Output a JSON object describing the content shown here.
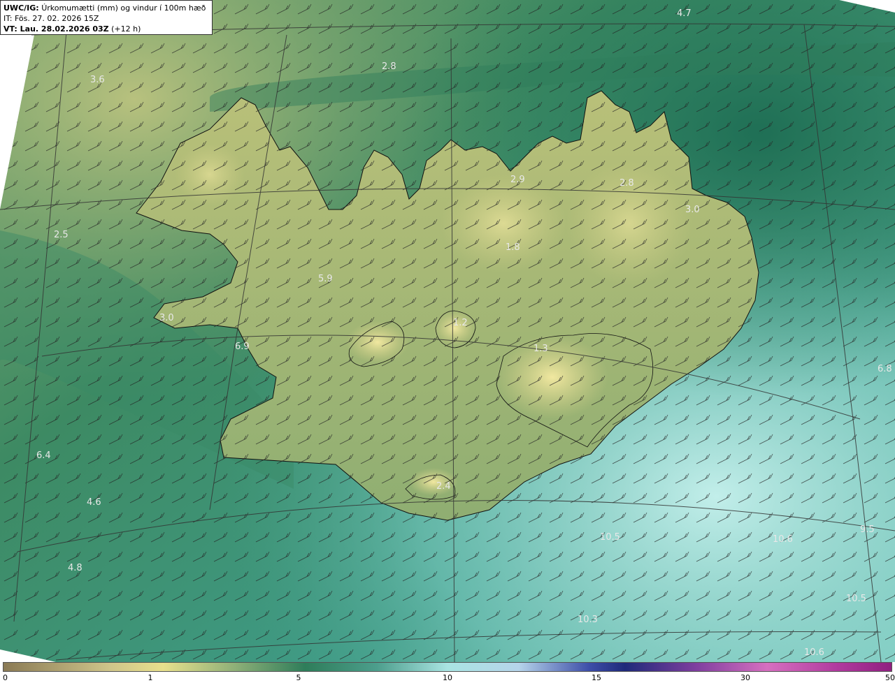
{
  "header": {
    "model_label": "UWC/IG:",
    "title": "Úrkomumætti (mm) og vindur í 100m hæð",
    "init_time": "IT: Fös. 27. 02. 2026 15Z",
    "valid_label": "VT: Lau. 28.02.2026 03Z",
    "valid_offset": "(+12 h)"
  },
  "map": {
    "region": "Iceland",
    "field": "precipitable water (mm)",
    "overlay": "wind barbs at 100 m",
    "colors": {
      "dry": "#8f8060",
      "low": "#e6df8a",
      "mid": "#2e7d5a",
      "high": "#a8e6e3",
      "coast": "#111111",
      "grid": "#333333"
    },
    "value_labels": [
      {
        "id": "v1",
        "text": "4.7"
      },
      {
        "id": "v2",
        "text": "2.8"
      },
      {
        "id": "v3",
        "text": "3.6"
      },
      {
        "id": "v4",
        "text": "2.9"
      },
      {
        "id": "v5",
        "text": "2.8"
      },
      {
        "id": "v6",
        "text": "3.0"
      },
      {
        "id": "v7",
        "text": "2.5"
      },
      {
        "id": "v8",
        "text": "5.9"
      },
      {
        "id": "v9",
        "text": "1.8"
      },
      {
        "id": "v10",
        "text": "3.0"
      },
      {
        "id": "v11",
        "text": "1.2"
      },
      {
        "id": "v12",
        "text": "6.9"
      },
      {
        "id": "v13",
        "text": "1.3"
      },
      {
        "id": "v14",
        "text": "6.8"
      },
      {
        "id": "v15",
        "text": "6.4"
      },
      {
        "id": "v16",
        "text": "4.6"
      },
      {
        "id": "v17",
        "text": "2.4"
      },
      {
        "id": "v18",
        "text": "4.8"
      },
      {
        "id": "v19",
        "text": "10.5"
      },
      {
        "id": "v20",
        "text": "10.6"
      },
      {
        "id": "v21",
        "text": "9.5"
      },
      {
        "id": "v22",
        "text": "10.3"
      },
      {
        "id": "v23",
        "text": "10.5"
      },
      {
        "id": "v24",
        "text": "10.6"
      }
    ]
  },
  "colorbar": {
    "ticks": [
      "0",
      "1",
      "5",
      "10",
      "15",
      "30",
      "50"
    ]
  }
}
